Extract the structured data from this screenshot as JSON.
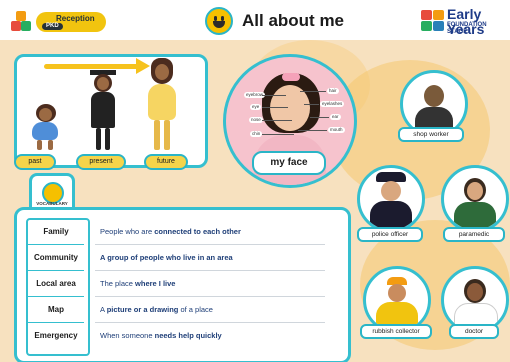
{
  "header": {
    "badge_label": "Reception",
    "badge_sub": "PKD",
    "title": "All about me",
    "logo_main": "Early Years",
    "logo_sub": "FOUNDATION STAGE"
  },
  "timeline": {
    "labels": [
      "past",
      "present",
      "future"
    ]
  },
  "face_diagram": {
    "caption": "my face",
    "parts_left": [
      "eyebrow",
      "eye",
      "nose",
      "chin"
    ],
    "parts_right": [
      "hair",
      "eyelashes",
      "ear",
      "mouth"
    ]
  },
  "people": [
    {
      "label": "shop worker"
    },
    {
      "label": "police officer"
    },
    {
      "label": "paramedic"
    },
    {
      "label": "rubbish collector"
    },
    {
      "label": "doctor"
    }
  ],
  "vocabulary": {
    "tab_label": "VOCABULARY",
    "items": [
      {
        "term": "Family",
        "def_pre": "People who are ",
        "def_bold": "connected to each other",
        "def_post": ""
      },
      {
        "term": "Community",
        "def_pre": "",
        "def_bold": "A group of people who live in an area",
        "def_post": ""
      },
      {
        "term": "Local area",
        "def_pre": "The place ",
        "def_bold": "where I live",
        "def_post": ""
      },
      {
        "term": "Map",
        "def_pre": "A ",
        "def_bold": "picture or a drawing",
        "def_post": " of a place"
      },
      {
        "term": "Emergency",
        "def_pre": "When someone ",
        "def_bold": "needs help quickly",
        "def_post": ""
      }
    ]
  },
  "colors": {
    "accent": "#35bfcf",
    "yellow": "#f6c21d",
    "background": "#f7e1bf",
    "text_blue": "#1f3f78"
  }
}
